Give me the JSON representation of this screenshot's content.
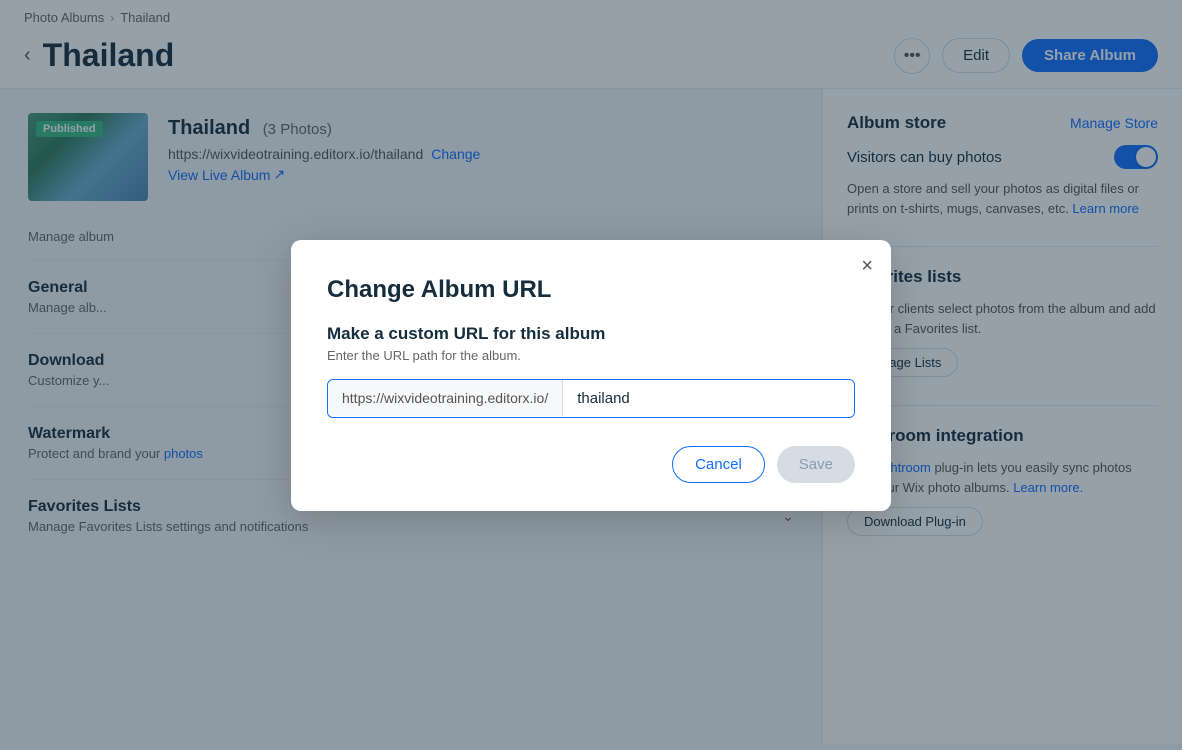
{
  "breadcrumb": {
    "parent": "Photo Albums",
    "current": "Thailand",
    "sep": "›"
  },
  "header": {
    "title": "Thailand",
    "more_label": "•••",
    "edit_label": "Edit",
    "share_label": "Share Album"
  },
  "album": {
    "name": "Thailand",
    "count_label": "(3 Photos)",
    "published_badge": "Published",
    "url": "https://wixvideotraining.editorx.io/thailand",
    "change_label": "Change",
    "view_live_label": "View Live Album",
    "manage_label": "Manage album"
  },
  "sections": [
    {
      "title": "General",
      "desc": "Manage alb..."
    },
    {
      "title": "Download",
      "desc": "Customize y..."
    },
    {
      "title": "Watermark",
      "desc": "Protect and brand your photos"
    },
    {
      "title": "Favorites Lists",
      "desc": "Manage Favorites Lists settings and notifications"
    }
  ],
  "right_panel": {
    "album_store": {
      "title": "Album store",
      "manage_store_label": "Manage Store",
      "toggle_label": "Visitors can buy photos",
      "desc": "Open a store and sell your photos as digital files or prints on t-shirts, mugs, canvases, etc.",
      "learn_more_label": "Learn more"
    },
    "favorites_lists": {
      "title": "Favorites lists",
      "desc": "Let your clients select photos from the album and add them to a Favorites list.",
      "manage_btn_label": "Manage Lists"
    },
    "lightroom": {
      "title": "Lightroom integration",
      "desc": "The Lightroom plug-in lets you easily sync photos with your Wix photo albums.",
      "learn_more_label": "Learn more.",
      "download_btn_label": "Download Plug-in"
    }
  },
  "modal": {
    "title": "Change Album URL",
    "subtitle": "Make a custom URL for this album",
    "hint": "Enter the URL path for the album.",
    "url_prefix": "https://wixvideotraining.editorx.io/",
    "url_value": "thailand",
    "cancel_label": "Cancel",
    "save_label": "Save",
    "close_icon": "×"
  }
}
